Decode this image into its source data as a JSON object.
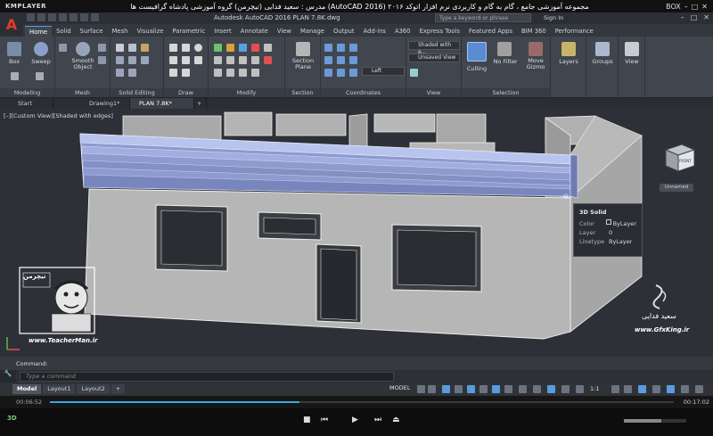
{
  "kmplayer": {
    "logo": "KMPLAYER",
    "caption": "مجموعه آموزشی جامع ، گام به گام و کاربردی نرم افزار اتوکد ۲۰۱۶ (AutoCAD 2016) مدرس : سعید فدایی (تیچرمن) گروه آموزشی پادشاه گرافیست ها",
    "box_label": "BOX",
    "win_controls": [
      "–",
      "□",
      "✕"
    ]
  },
  "autocad": {
    "logo": "A",
    "title": "Autodesk AutoCAD 2016    PLAN 7.8K.dwg",
    "search_placeholder": "Type a keyword or phrase",
    "signin": "Sign In",
    "win_controls": [
      "–",
      "□",
      "✕"
    ]
  },
  "ribbon_tabs": [
    "Home",
    "Solid",
    "Surface",
    "Mesh",
    "Visualize",
    "Parametric",
    "Insert",
    "Annotate",
    "View",
    "Manage",
    "Output",
    "Add-ins",
    "A360",
    "Express Tools",
    "Featured Apps",
    "BIM 360",
    "Performance"
  ],
  "ribbon": {
    "panels": [
      "Modeling",
      "Mesh",
      "Solid Editing",
      "Draw",
      "Modify",
      "Section",
      "Coordinates",
      "View",
      "Selection"
    ],
    "tools": {
      "box": "Box",
      "sweep": "Sweep",
      "smooth_object": "Smooth\nObject",
      "section_plane": "Section\nPlane",
      "culling": "Culling",
      "no_filter": "No Filter",
      "move_gizmo": "Move\nGizmo",
      "layers": "Layers",
      "groups": "Groups",
      "view": "View"
    },
    "dropdowns": {
      "visual_style": "Shaded with e...",
      "view_preset": "Unsaved View",
      "view_dir": "Left"
    }
  },
  "file_tabs": [
    "Start",
    "Drawing1*",
    "PLAN 7.8K*",
    "+"
  ],
  "viewport": {
    "label": "[–][Custom View][Shaded with edges]",
    "viewcube_label": "FRONT",
    "unnamed": "Unnamed"
  },
  "tooltip": {
    "title": "3D Solid",
    "rows": [
      {
        "key": "Color",
        "value": "ByLayer"
      },
      {
        "key": "Layer",
        "value": "0"
      },
      {
        "key": "Linetype",
        "value": "ByLayer"
      }
    ]
  },
  "watermarks": {
    "left_site": "www.TeacherMan.ir",
    "right_site": "www.GfxKing.ir",
    "right_name": "سعید فدایی",
    "left_logo_text": "تیچرمن"
  },
  "command": {
    "history": "Command:",
    "placeholder": "Type a command",
    "tools_icon": "🔧"
  },
  "status": {
    "layout_tabs": [
      "Model",
      "Layout1",
      "Layout2",
      "+"
    ],
    "model": "MODEL",
    "scale": "1:1"
  },
  "player": {
    "time_current": "00:06:52",
    "time_total": "00:17:02",
    "progress": 0.4
  },
  "colors": {
    "accent": "#5a9be0",
    "solid_main": "#b8b8b8",
    "cornice": "#9aa8d6",
    "viewport_bg": "#2d3137"
  }
}
